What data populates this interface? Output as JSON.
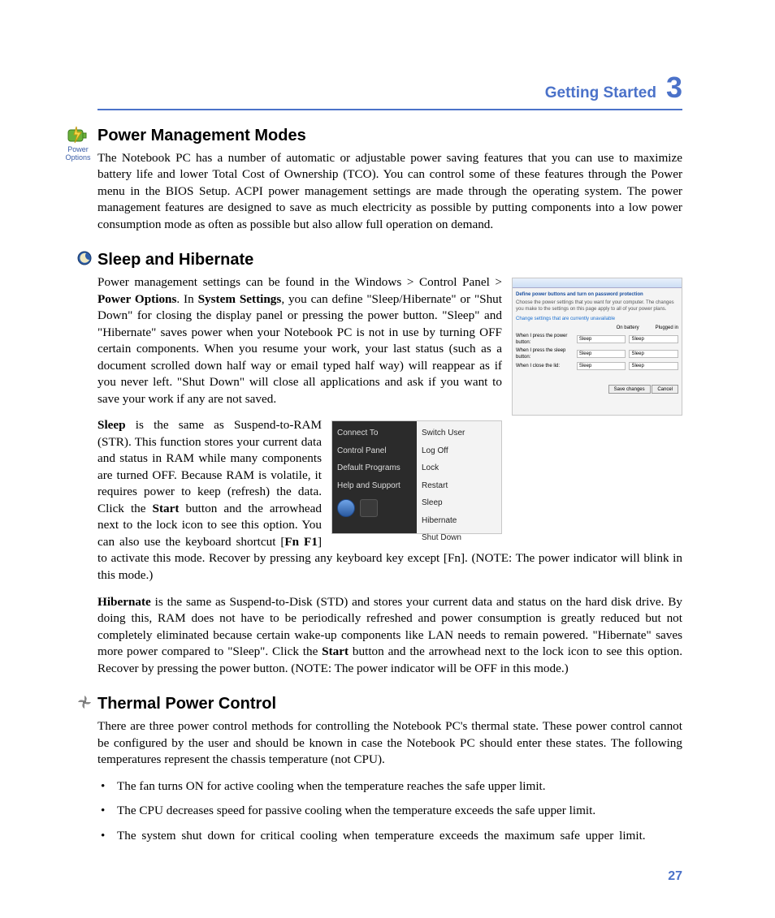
{
  "chapter": {
    "title": "Getting Started",
    "number": "3"
  },
  "power_mgmt": {
    "icon_caption": "Power Options",
    "heading": "Power Management Modes",
    "body": "The Notebook PC has a number of automatic or adjustable power saving features that you can use to maximize battery life and lower Total Cost of Ownership (TCO). You can control some of these features through the Power menu in the BIOS Setup. ACPI power management settings are made through the operating system. The power management features are designed to save as much electricity as possible by putting components into a low power consumption mode as often as possible but also allow full operation on demand."
  },
  "sleep": {
    "heading": "Sleep and Hibernate",
    "p1_1": "Power management settings can be found in the Windows ",
    "gt1": ">",
    "p1_2": " Control Panel ",
    "gt2": ">",
    "p1_3": " ",
    "bold_power_options": "Power Options",
    "p1_4": ". In ",
    "bold_system_settings": "System Settings",
    "p1_5": ", you can define \"Sleep/Hibernate\" or \"Shut Down\" for closing the display panel or pressing the power button. \"Sleep\" and \"Hibernate\" saves power when your Notebook PC is not in use by turning OFF certain components. When you resume your work, your last status (such as a document scrolled down half way or email typed half way) will reappear as if you never left. \"Shut Down\" will close all applications and ask if you want to save your work if any are not saved.",
    "p2_bold_sleep": "Sleep",
    "p2_1": " is the same as Suspend-to-RAM (STR). This function stores your current data and status in RAM while many components are turned OFF. Because RAM is volatile, it requires power to keep (refresh) the data. Click the ",
    "bold_start1": "Start",
    "p2_2": " button and the arrowhead next to the lock icon to see this option. You can also use the keyboard shortcut [",
    "bold_fnf1": "Fn F1",
    "p2_3": "] to activate this mode. Recover by pressing any keyboard key except [Fn]. (NOTE: The power indicator will blink in this mode.)",
    "p3_bold_hibernate": "Hibernate",
    "p3_1": " is the same as  Suspend-to-Disk (STD) and stores your current data and status on the hard disk drive. By doing this, RAM does not have to be periodically refreshed and power consumption is greatly reduced but not completely eliminated because certain wake-up components like LAN needs to remain powered. \"Hibernate\" saves more power compared to \"Sleep\". Click the ",
    "bold_start2": "Start",
    "p3_2": " button and the arrowhead next to the lock icon to see this option. Recover by pressing the power button. (NOTE: The power indicator will be OFF in this mode.)"
  },
  "dialog_img": {
    "title1": "Define power buttons and turn on password protection",
    "sub": "Choose the power settings that you want for your computer. The changes you make to the settings on this page apply to all of your power plans.",
    "link": "Change settings that are currently unavailable",
    "row1": "When I press the power button:",
    "row2": "When I press the sleep button:",
    "row3": "When I close the lid:",
    "sel": "Sleep",
    "colA": "On battery",
    "colB": "Plugged in",
    "save": "Save changes",
    "cancel": "Cancel"
  },
  "menu_img": {
    "left": [
      "Connect To",
      "Control Panel",
      "Default Programs",
      "Help and Support"
    ],
    "right": [
      "Switch User",
      "Log Off",
      "Lock",
      "Restart",
      "Sleep",
      "Hibernate",
      "Shut Down"
    ]
  },
  "thermal": {
    "heading": "Thermal Power Control",
    "body": "There are three power control methods for controlling the Notebook PC's thermal state. These power control cannot be configured by the user and should be known in case the Notebook PC should enter these states. The following temperatures represent the chassis temperature (not CPU).",
    "bullets": [
      "The fan turns ON for active cooling when the temperature reaches the safe upper limit.",
      "The CPU decreases speed for passive cooling when the temperature exceeds the safe upper limit.",
      "The system shut down for critical cooling when temperature exceeds the maximum safe upper limit."
    ]
  },
  "page_number": "27"
}
